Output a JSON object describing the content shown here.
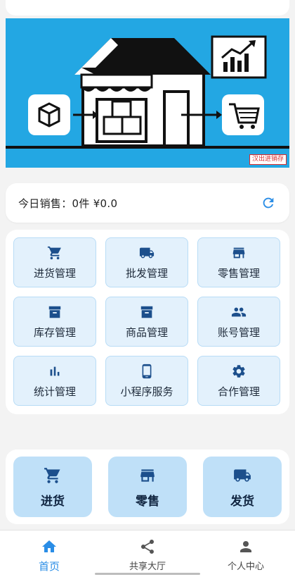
{
  "banner": {
    "tag": "汉出进销存",
    "alt": "store illustration"
  },
  "sales": {
    "text": "今日销售：0件 ¥0.0",
    "refresh_icon": "refresh-icon"
  },
  "menu": {
    "items": [
      {
        "label": "进货管理",
        "icon": "cart-icon"
      },
      {
        "label": "批发管理",
        "icon": "truck-icon"
      },
      {
        "label": "零售管理",
        "icon": "store-icon"
      },
      {
        "label": "库存管理",
        "icon": "archive-icon"
      },
      {
        "label": "商品管理",
        "icon": "archive-icon"
      },
      {
        "label": "账号管理",
        "icon": "people-icon"
      },
      {
        "label": "统计管理",
        "icon": "bar-chart-icon"
      },
      {
        "label": "小程序服务",
        "icon": "phone-icon"
      },
      {
        "label": "合作管理",
        "icon": "gear-icon"
      }
    ]
  },
  "quick": {
    "items": [
      {
        "label": "进货",
        "icon": "cart-icon"
      },
      {
        "label": "零售",
        "icon": "store-icon"
      },
      {
        "label": "发货",
        "icon": "truck-icon"
      }
    ]
  },
  "tabbar": {
    "items": [
      {
        "label": "首页",
        "icon": "home-icon",
        "active": true
      },
      {
        "label": "共享大厅",
        "icon": "share-icon",
        "active": false
      },
      {
        "label": "个人中心",
        "icon": "person-icon",
        "active": false
      }
    ]
  },
  "colors": {
    "accent": "#2a8de6",
    "icon": "#1c4f8c",
    "banner_bg": "#23a7e3",
    "tile_bg": "#e3f1fc",
    "quick_bg": "#bfe0f8"
  }
}
